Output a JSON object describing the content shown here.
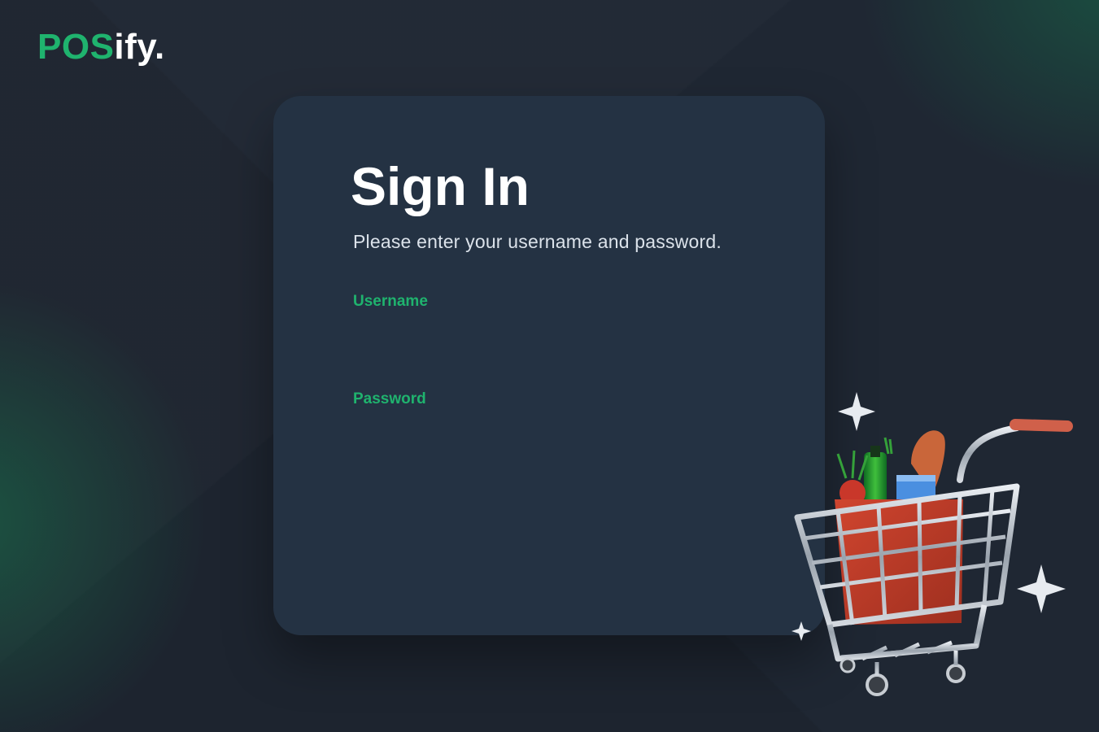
{
  "brand": {
    "logo_primary": "POS",
    "logo_secondary": "ify.",
    "primary_color": "#1fb36e"
  },
  "signin": {
    "title": "Sign In",
    "subtitle": "Please enter your username and password.",
    "username_label": "Username",
    "username_value": "",
    "password_label": "Password",
    "password_value": ""
  },
  "illustration": {
    "icon": "shopping-cart-icon"
  }
}
